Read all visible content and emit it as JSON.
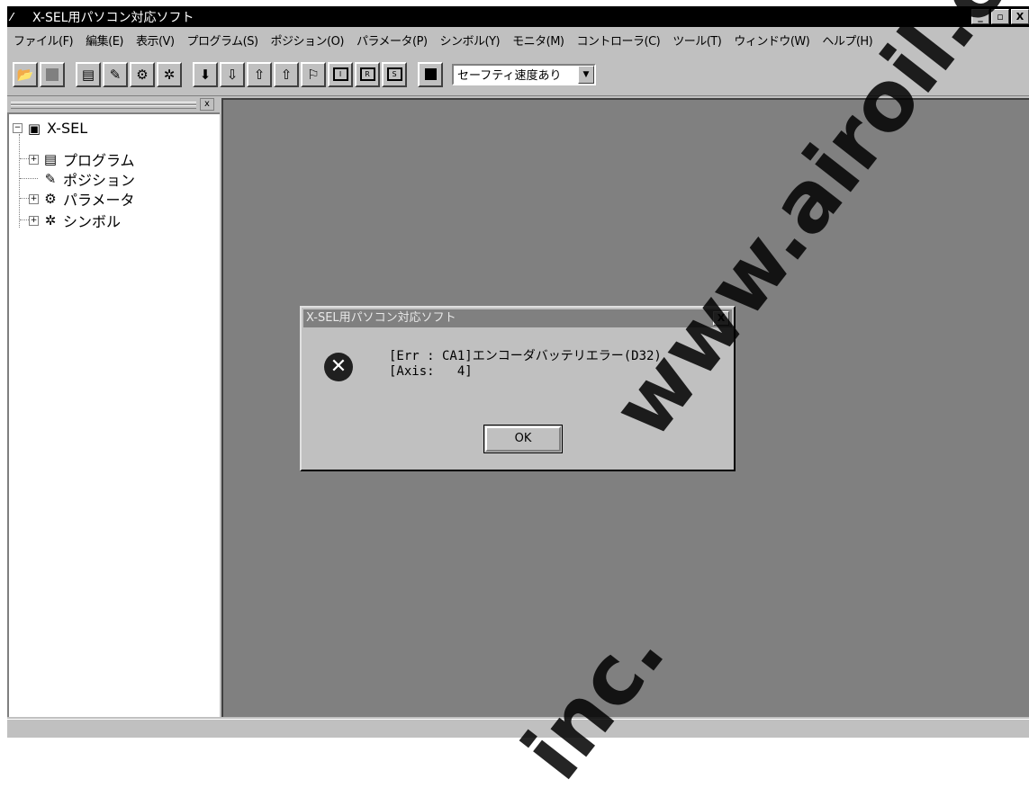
{
  "window": {
    "title": "X-SEL用パソコン対応ソフト",
    "buttons": {
      "minimize": "_",
      "maximize": "▫",
      "close": "X"
    }
  },
  "menu": [
    "ファイル(F)",
    "編集(E)",
    "表示(V)",
    "プログラム(S)",
    "ポジション(O)",
    "パラメータ(P)",
    "シンボル(Y)",
    "モニタ(M)",
    "コントローラ(C)",
    "ツール(T)",
    "ウィンドウ(W)",
    "ヘルプ(H)"
  ],
  "toolbar": {
    "speed_select": "セーフティ速度あり",
    "icons": [
      "open-folder-icon",
      "stop-square-icon",
      "program-icon",
      "pencil-icon",
      "parameter-icon",
      "symbol-icon",
      "arrow-down-filled-icon",
      "arrow-down-outline-icon",
      "arrow-up-outline-icon",
      "arrow-up-hollow-icon",
      "flag-icon",
      "io-monitor-icon",
      "register-monitor-icon",
      "status-monitor-icon",
      "black-square-icon"
    ]
  },
  "tree": {
    "root": "X-SEL",
    "children": [
      "プログラム",
      "ポジション",
      "パラメータ",
      "シンボル"
    ]
  },
  "dialog": {
    "title": "X-SEL用パソコン対応ソフト",
    "close": "X",
    "message_line1": "[Err : CA1]エンコーダバッテリエラー(D32)",
    "message_line2": "[Axis:   4]",
    "ok_label": "OK"
  },
  "watermark": "www.airoil.com",
  "watermark_bottom": "inc."
}
